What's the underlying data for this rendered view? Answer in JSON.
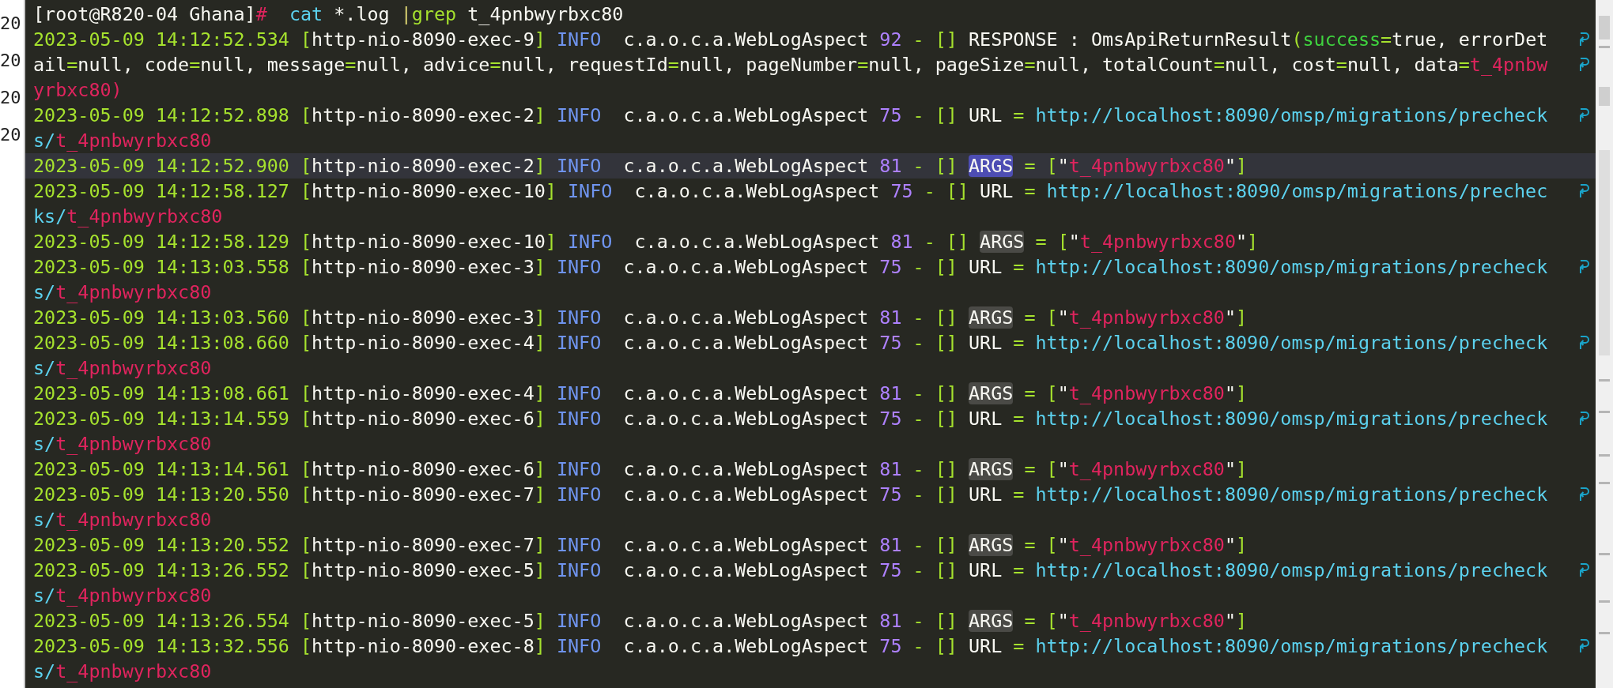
{
  "gutter": [
    "20",
    "20",
    "20",
    "20"
  ],
  "rows": [
    {
      "selected": false,
      "wrapped": false,
      "segments": [
        {
          "kind": "plain",
          "text": "[root@R820-04 Ghana]"
        },
        {
          "kind": "prompt",
          "text": "#"
        },
        {
          "kind": "command",
          "text": "  cat"
        },
        {
          "kind": "plain",
          "text": " *.log "
        },
        {
          "kind": "pipe",
          "text": "|"
        },
        {
          "kind": "grep",
          "text": "grep"
        },
        {
          "kind": "plain",
          "text": " t_4pnbwyrbxc80"
        }
      ]
    },
    {
      "selected": false,
      "wrapped": true,
      "segments": [
        {
          "kind": "date",
          "text": "2023-05-09 14:12:52.534 "
        },
        {
          "kind": "bracket",
          "text": "["
        },
        {
          "kind": "plain",
          "text": "http-nio-8090-exec-9"
        },
        {
          "kind": "bracket",
          "text": "]"
        },
        {
          "kind": "info",
          "text": " INFO "
        },
        {
          "kind": "plain",
          "text": " c.a.o.c.a.WebLogAspect "
        },
        {
          "kind": "number",
          "text": "92"
        },
        {
          "kind": "op",
          "text": " - "
        },
        {
          "kind": "bracket",
          "text": "[]"
        },
        {
          "kind": "plain",
          "text": " RESPONSE : OmsApiReturnResult"
        },
        {
          "kind": "bracket",
          "text": "("
        },
        {
          "kind": "success",
          "text": "success"
        },
        {
          "kind": "op",
          "text": "="
        },
        {
          "kind": "plain",
          "text": "true, errorDet"
        }
      ]
    },
    {
      "selected": false,
      "wrapped": true,
      "segments": [
        {
          "kind": "plain",
          "text": "ail"
        },
        {
          "kind": "op",
          "text": "="
        },
        {
          "kind": "plain",
          "text": "null, code"
        },
        {
          "kind": "op",
          "text": "="
        },
        {
          "kind": "plain",
          "text": "null, message"
        },
        {
          "kind": "op",
          "text": "="
        },
        {
          "kind": "plain",
          "text": "null, advice"
        },
        {
          "kind": "op",
          "text": "="
        },
        {
          "kind": "plain",
          "text": "null, requestId"
        },
        {
          "kind": "op",
          "text": "="
        },
        {
          "kind": "plain",
          "text": "null, pageNumber"
        },
        {
          "kind": "op",
          "text": "="
        },
        {
          "kind": "plain",
          "text": "null, pageSize"
        },
        {
          "kind": "op",
          "text": "="
        },
        {
          "kind": "plain",
          "text": "null, totalCount"
        },
        {
          "kind": "op",
          "text": "="
        },
        {
          "kind": "plain",
          "text": "null, cost"
        },
        {
          "kind": "op",
          "text": "="
        },
        {
          "kind": "plain",
          "text": "null, data"
        },
        {
          "kind": "op",
          "text": "="
        },
        {
          "kind": "value",
          "text": "t_4pnbw"
        }
      ]
    },
    {
      "selected": false,
      "wrapped": false,
      "segments": [
        {
          "kind": "value",
          "text": "yrbxc80)"
        }
      ]
    },
    {
      "selected": false,
      "wrapped": true,
      "segments": [
        {
          "kind": "date",
          "text": "2023-05-09 14:12:52.898 "
        },
        {
          "kind": "bracket",
          "text": "["
        },
        {
          "kind": "plain",
          "text": "http-nio-8090-exec-2"
        },
        {
          "kind": "bracket",
          "text": "]"
        },
        {
          "kind": "info",
          "text": " INFO "
        },
        {
          "kind": "plain",
          "text": " c.a.o.c.a.WebLogAspect "
        },
        {
          "kind": "number",
          "text": "75"
        },
        {
          "kind": "op",
          "text": " - "
        },
        {
          "kind": "bracket",
          "text": "[]"
        },
        {
          "kind": "plain",
          "text": " URL "
        },
        {
          "kind": "op",
          "text": "= "
        },
        {
          "kind": "url",
          "text": "http://localhost:8090/omsp/migrations/precheck"
        }
      ]
    },
    {
      "selected": false,
      "wrapped": false,
      "segments": [
        {
          "kind": "url",
          "text": "s/"
        },
        {
          "kind": "value",
          "text": "t_4pnbwyrbxc80"
        }
      ]
    },
    {
      "selected": true,
      "wrapped": false,
      "segments": [
        {
          "kind": "date",
          "text": "2023-05-09 14:12:52.900 "
        },
        {
          "kind": "bracket",
          "text": "["
        },
        {
          "kind": "plain",
          "text": "http-nio-8090-exec-2"
        },
        {
          "kind": "bracket",
          "text": "]"
        },
        {
          "kind": "info",
          "text": " INFO "
        },
        {
          "kind": "plain",
          "text": " c.a.o.c.a.WebLogAspect "
        },
        {
          "kind": "number",
          "text": "81"
        },
        {
          "kind": "op",
          "text": " - "
        },
        {
          "kind": "bracket",
          "text": "[] "
        },
        {
          "kind": "match-current",
          "text": "ARGS"
        },
        {
          "kind": "op",
          "text": " = "
        },
        {
          "kind": "bracket",
          "text": "["
        },
        {
          "kind": "plain",
          "text": "\""
        },
        {
          "kind": "value",
          "text": "t_4pnbwyrbxc80"
        },
        {
          "kind": "plain",
          "text": "\""
        },
        {
          "kind": "bracket",
          "text": "]"
        }
      ]
    },
    {
      "selected": false,
      "wrapped": true,
      "segments": [
        {
          "kind": "date",
          "text": "2023-05-09 14:12:58.127 "
        },
        {
          "kind": "bracket",
          "text": "["
        },
        {
          "kind": "plain",
          "text": "http-nio-8090-exec-10"
        },
        {
          "kind": "bracket",
          "text": "]"
        },
        {
          "kind": "info",
          "text": " INFO "
        },
        {
          "kind": "plain",
          "text": " c.a.o.c.a.WebLogAspect "
        },
        {
          "kind": "number",
          "text": "75"
        },
        {
          "kind": "op",
          "text": " - "
        },
        {
          "kind": "bracket",
          "text": "[]"
        },
        {
          "kind": "plain",
          "text": " URL "
        },
        {
          "kind": "op",
          "text": "= "
        },
        {
          "kind": "url",
          "text": "http://localhost:8090/omsp/migrations/prechec"
        }
      ]
    },
    {
      "selected": false,
      "wrapped": false,
      "segments": [
        {
          "kind": "url",
          "text": "ks/"
        },
        {
          "kind": "value",
          "text": "t_4pnbwyrbxc80"
        }
      ]
    },
    {
      "selected": false,
      "wrapped": false,
      "segments": [
        {
          "kind": "date",
          "text": "2023-05-09 14:12:58.129 "
        },
        {
          "kind": "bracket",
          "text": "["
        },
        {
          "kind": "plain",
          "text": "http-nio-8090-exec-10"
        },
        {
          "kind": "bracket",
          "text": "]"
        },
        {
          "kind": "info",
          "text": " INFO "
        },
        {
          "kind": "plain",
          "text": " c.a.o.c.a.WebLogAspect "
        },
        {
          "kind": "number",
          "text": "81"
        },
        {
          "kind": "op",
          "text": " - "
        },
        {
          "kind": "bracket",
          "text": "[] "
        },
        {
          "kind": "match",
          "text": "ARGS"
        },
        {
          "kind": "op",
          "text": " = "
        },
        {
          "kind": "bracket",
          "text": "["
        },
        {
          "kind": "plain",
          "text": "\""
        },
        {
          "kind": "value",
          "text": "t_4pnbwyrbxc80"
        },
        {
          "kind": "plain",
          "text": "\""
        },
        {
          "kind": "bracket",
          "text": "]"
        }
      ]
    },
    {
      "selected": false,
      "wrapped": true,
      "segments": [
        {
          "kind": "date",
          "text": "2023-05-09 14:13:03.558 "
        },
        {
          "kind": "bracket",
          "text": "["
        },
        {
          "kind": "plain",
          "text": "http-nio-8090-exec-3"
        },
        {
          "kind": "bracket",
          "text": "]"
        },
        {
          "kind": "info",
          "text": " INFO "
        },
        {
          "kind": "plain",
          "text": " c.a.o.c.a.WebLogAspect "
        },
        {
          "kind": "number",
          "text": "75"
        },
        {
          "kind": "op",
          "text": " - "
        },
        {
          "kind": "bracket",
          "text": "[]"
        },
        {
          "kind": "plain",
          "text": " URL "
        },
        {
          "kind": "op",
          "text": "= "
        },
        {
          "kind": "url",
          "text": "http://localhost:8090/omsp/migrations/precheck"
        }
      ]
    },
    {
      "selected": false,
      "wrapped": false,
      "segments": [
        {
          "kind": "url",
          "text": "s/"
        },
        {
          "kind": "value",
          "text": "t_4pnbwyrbxc80"
        }
      ]
    },
    {
      "selected": false,
      "wrapped": false,
      "segments": [
        {
          "kind": "date",
          "text": "2023-05-09 14:13:03.560 "
        },
        {
          "kind": "bracket",
          "text": "["
        },
        {
          "kind": "plain",
          "text": "http-nio-8090-exec-3"
        },
        {
          "kind": "bracket",
          "text": "]"
        },
        {
          "kind": "info",
          "text": " INFO "
        },
        {
          "kind": "plain",
          "text": " c.a.o.c.a.WebLogAspect "
        },
        {
          "kind": "number",
          "text": "81"
        },
        {
          "kind": "op",
          "text": " - "
        },
        {
          "kind": "bracket",
          "text": "[] "
        },
        {
          "kind": "match",
          "text": "ARGS"
        },
        {
          "kind": "op",
          "text": " = "
        },
        {
          "kind": "bracket",
          "text": "["
        },
        {
          "kind": "plain",
          "text": "\""
        },
        {
          "kind": "value",
          "text": "t_4pnbwyrbxc80"
        },
        {
          "kind": "plain",
          "text": "\""
        },
        {
          "kind": "bracket",
          "text": "]"
        }
      ]
    },
    {
      "selected": false,
      "wrapped": true,
      "segments": [
        {
          "kind": "date",
          "text": "2023-05-09 14:13:08.660 "
        },
        {
          "kind": "bracket",
          "text": "["
        },
        {
          "kind": "plain",
          "text": "http-nio-8090-exec-4"
        },
        {
          "kind": "bracket",
          "text": "]"
        },
        {
          "kind": "info",
          "text": " INFO "
        },
        {
          "kind": "plain",
          "text": " c.a.o.c.a.WebLogAspect "
        },
        {
          "kind": "number",
          "text": "75"
        },
        {
          "kind": "op",
          "text": " - "
        },
        {
          "kind": "bracket",
          "text": "[]"
        },
        {
          "kind": "plain",
          "text": " URL "
        },
        {
          "kind": "op",
          "text": "= "
        },
        {
          "kind": "url",
          "text": "http://localhost:8090/omsp/migrations/precheck"
        }
      ]
    },
    {
      "selected": false,
      "wrapped": false,
      "segments": [
        {
          "kind": "url",
          "text": "s/"
        },
        {
          "kind": "value",
          "text": "t_4pnbwyrbxc80"
        }
      ]
    },
    {
      "selected": false,
      "wrapped": false,
      "segments": [
        {
          "kind": "date",
          "text": "2023-05-09 14:13:08.661 "
        },
        {
          "kind": "bracket",
          "text": "["
        },
        {
          "kind": "plain",
          "text": "http-nio-8090-exec-4"
        },
        {
          "kind": "bracket",
          "text": "]"
        },
        {
          "kind": "info",
          "text": " INFO "
        },
        {
          "kind": "plain",
          "text": " c.a.o.c.a.WebLogAspect "
        },
        {
          "kind": "number",
          "text": "81"
        },
        {
          "kind": "op",
          "text": " - "
        },
        {
          "kind": "bracket",
          "text": "[] "
        },
        {
          "kind": "match",
          "text": "ARGS"
        },
        {
          "kind": "op",
          "text": " = "
        },
        {
          "kind": "bracket",
          "text": "["
        },
        {
          "kind": "plain",
          "text": "\""
        },
        {
          "kind": "value",
          "text": "t_4pnbwyrbxc80"
        },
        {
          "kind": "plain",
          "text": "\""
        },
        {
          "kind": "bracket",
          "text": "]"
        }
      ]
    },
    {
      "selected": false,
      "wrapped": true,
      "segments": [
        {
          "kind": "date",
          "text": "2023-05-09 14:13:14.559 "
        },
        {
          "kind": "bracket",
          "text": "["
        },
        {
          "kind": "plain",
          "text": "http-nio-8090-exec-6"
        },
        {
          "kind": "bracket",
          "text": "]"
        },
        {
          "kind": "info",
          "text": " INFO "
        },
        {
          "kind": "plain",
          "text": " c.a.o.c.a.WebLogAspect "
        },
        {
          "kind": "number",
          "text": "75"
        },
        {
          "kind": "op",
          "text": " - "
        },
        {
          "kind": "bracket",
          "text": "[]"
        },
        {
          "kind": "plain",
          "text": " URL "
        },
        {
          "kind": "op",
          "text": "= "
        },
        {
          "kind": "url",
          "text": "http://localhost:8090/omsp/migrations/precheck"
        }
      ]
    },
    {
      "selected": false,
      "wrapped": false,
      "segments": [
        {
          "kind": "url",
          "text": "s/"
        },
        {
          "kind": "value",
          "text": "t_4pnbwyrbxc80"
        }
      ]
    },
    {
      "selected": false,
      "wrapped": false,
      "segments": [
        {
          "kind": "date",
          "text": "2023-05-09 14:13:14.561 "
        },
        {
          "kind": "bracket",
          "text": "["
        },
        {
          "kind": "plain",
          "text": "http-nio-8090-exec-6"
        },
        {
          "kind": "bracket",
          "text": "]"
        },
        {
          "kind": "info",
          "text": " INFO "
        },
        {
          "kind": "plain",
          "text": " c.a.o.c.a.WebLogAspect "
        },
        {
          "kind": "number",
          "text": "81"
        },
        {
          "kind": "op",
          "text": " - "
        },
        {
          "kind": "bracket",
          "text": "[] "
        },
        {
          "kind": "match",
          "text": "ARGS"
        },
        {
          "kind": "op",
          "text": " = "
        },
        {
          "kind": "bracket",
          "text": "["
        },
        {
          "kind": "plain",
          "text": "\""
        },
        {
          "kind": "value",
          "text": "t_4pnbwyrbxc80"
        },
        {
          "kind": "plain",
          "text": "\""
        },
        {
          "kind": "bracket",
          "text": "]"
        }
      ]
    },
    {
      "selected": false,
      "wrapped": true,
      "segments": [
        {
          "kind": "date",
          "text": "2023-05-09 14:13:20.550 "
        },
        {
          "kind": "bracket",
          "text": "["
        },
        {
          "kind": "plain",
          "text": "http-nio-8090-exec-7"
        },
        {
          "kind": "bracket",
          "text": "]"
        },
        {
          "kind": "info",
          "text": " INFO "
        },
        {
          "kind": "plain",
          "text": " c.a.o.c.a.WebLogAspect "
        },
        {
          "kind": "number",
          "text": "75"
        },
        {
          "kind": "op",
          "text": " - "
        },
        {
          "kind": "bracket",
          "text": "[]"
        },
        {
          "kind": "plain",
          "text": " URL "
        },
        {
          "kind": "op",
          "text": "= "
        },
        {
          "kind": "url",
          "text": "http://localhost:8090/omsp/migrations/precheck"
        }
      ]
    },
    {
      "selected": false,
      "wrapped": false,
      "segments": [
        {
          "kind": "url",
          "text": "s/"
        },
        {
          "kind": "value",
          "text": "t_4pnbwyrbxc80"
        }
      ]
    },
    {
      "selected": false,
      "wrapped": false,
      "segments": [
        {
          "kind": "date",
          "text": "2023-05-09 14:13:20.552 "
        },
        {
          "kind": "bracket",
          "text": "["
        },
        {
          "kind": "plain",
          "text": "http-nio-8090-exec-7"
        },
        {
          "kind": "bracket",
          "text": "]"
        },
        {
          "kind": "info",
          "text": " INFO "
        },
        {
          "kind": "plain",
          "text": " c.a.o.c.a.WebLogAspect "
        },
        {
          "kind": "number",
          "text": "81"
        },
        {
          "kind": "op",
          "text": " - "
        },
        {
          "kind": "bracket",
          "text": "[] "
        },
        {
          "kind": "match",
          "text": "ARGS"
        },
        {
          "kind": "op",
          "text": " = "
        },
        {
          "kind": "bracket",
          "text": "["
        },
        {
          "kind": "plain",
          "text": "\""
        },
        {
          "kind": "value",
          "text": "t_4pnbwyrbxc80"
        },
        {
          "kind": "plain",
          "text": "\""
        },
        {
          "kind": "bracket",
          "text": "]"
        }
      ]
    },
    {
      "selected": false,
      "wrapped": true,
      "segments": [
        {
          "kind": "date",
          "text": "2023-05-09 14:13:26.552 "
        },
        {
          "kind": "bracket",
          "text": "["
        },
        {
          "kind": "plain",
          "text": "http-nio-8090-exec-5"
        },
        {
          "kind": "bracket",
          "text": "]"
        },
        {
          "kind": "info",
          "text": " INFO "
        },
        {
          "kind": "plain",
          "text": " c.a.o.c.a.WebLogAspect "
        },
        {
          "kind": "number",
          "text": "75"
        },
        {
          "kind": "op",
          "text": " - "
        },
        {
          "kind": "bracket",
          "text": "[]"
        },
        {
          "kind": "plain",
          "text": " URL "
        },
        {
          "kind": "op",
          "text": "= "
        },
        {
          "kind": "url",
          "text": "http://localhost:8090/omsp/migrations/precheck"
        }
      ]
    },
    {
      "selected": false,
      "wrapped": false,
      "segments": [
        {
          "kind": "url",
          "text": "s/"
        },
        {
          "kind": "value",
          "text": "t_4pnbwyrbxc80"
        }
      ]
    },
    {
      "selected": false,
      "wrapped": false,
      "segments": [
        {
          "kind": "date",
          "text": "2023-05-09 14:13:26.554 "
        },
        {
          "kind": "bracket",
          "text": "["
        },
        {
          "kind": "plain",
          "text": "http-nio-8090-exec-5"
        },
        {
          "kind": "bracket",
          "text": "]"
        },
        {
          "kind": "info",
          "text": " INFO "
        },
        {
          "kind": "plain",
          "text": " c.a.o.c.a.WebLogAspect "
        },
        {
          "kind": "number",
          "text": "81"
        },
        {
          "kind": "op",
          "text": " - "
        },
        {
          "kind": "bracket",
          "text": "[] "
        },
        {
          "kind": "match",
          "text": "ARGS"
        },
        {
          "kind": "op",
          "text": " = "
        },
        {
          "kind": "bracket",
          "text": "["
        },
        {
          "kind": "plain",
          "text": "\""
        },
        {
          "kind": "value",
          "text": "t_4pnbwyrbxc80"
        },
        {
          "kind": "plain",
          "text": "\""
        },
        {
          "kind": "bracket",
          "text": "]"
        }
      ]
    },
    {
      "selected": false,
      "wrapped": true,
      "segments": [
        {
          "kind": "date",
          "text": "2023-05-09 14:13:32.556 "
        },
        {
          "kind": "bracket",
          "text": "["
        },
        {
          "kind": "plain",
          "text": "http-nio-8090-exec-8"
        },
        {
          "kind": "bracket",
          "text": "]"
        },
        {
          "kind": "info",
          "text": " INFO "
        },
        {
          "kind": "plain",
          "text": " c.a.o.c.a.WebLogAspect "
        },
        {
          "kind": "number",
          "text": "75"
        },
        {
          "kind": "op",
          "text": " - "
        },
        {
          "kind": "bracket",
          "text": "[]"
        },
        {
          "kind": "plain",
          "text": " URL "
        },
        {
          "kind": "op",
          "text": "= "
        },
        {
          "kind": "url",
          "text": "http://localhost:8090/omsp/migrations/precheck"
        }
      ]
    },
    {
      "selected": false,
      "wrapped": false,
      "segments": [
        {
          "kind": "url",
          "text": "s/"
        },
        {
          "kind": "value",
          "text": "t_4pnbwyrbxc80"
        }
      ]
    }
  ]
}
